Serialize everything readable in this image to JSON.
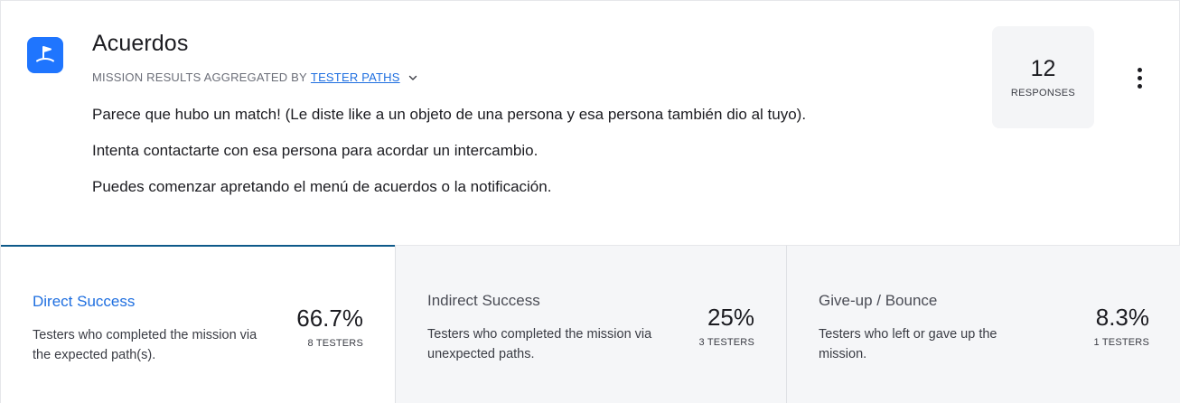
{
  "mission": {
    "icon": "flag-icon",
    "title": "Acuerdos",
    "subtitle_prefix": "MISSION RESULTS AGGREGATED BY",
    "subtitle_link": "TESTER PATHS",
    "description": [
      "Parece que hubo un match! (Le diste like a un objeto de una persona y esa persona también dio al tuyo).",
      "Intenta contactarte con esa persona para acordar un intercambio.",
      "Puedes comenzar apretando el menú de acuerdos o la notificación."
    ]
  },
  "responses": {
    "count": "12",
    "label": "RESPONSES"
  },
  "stats": [
    {
      "title": "Direct Success",
      "description": "Testers who completed the mission via the expected path(s).",
      "percent": "66.7%",
      "testers": "8 TESTERS"
    },
    {
      "title": "Indirect Success",
      "description": "Testers who completed the mission via unexpected paths.",
      "percent": "25%",
      "testers": "3 TESTERS"
    },
    {
      "title": "Give-up / Bounce",
      "description": "Testers who left or gave up the mission.",
      "percent": "8.3%",
      "testers": "1 TESTERS"
    }
  ],
  "colors": {
    "accent": "#1f6fe0",
    "icon_bg": "#1f75fe",
    "active_tab_border": "#0e5a8a",
    "panel_bg": "#f5f6f8"
  }
}
